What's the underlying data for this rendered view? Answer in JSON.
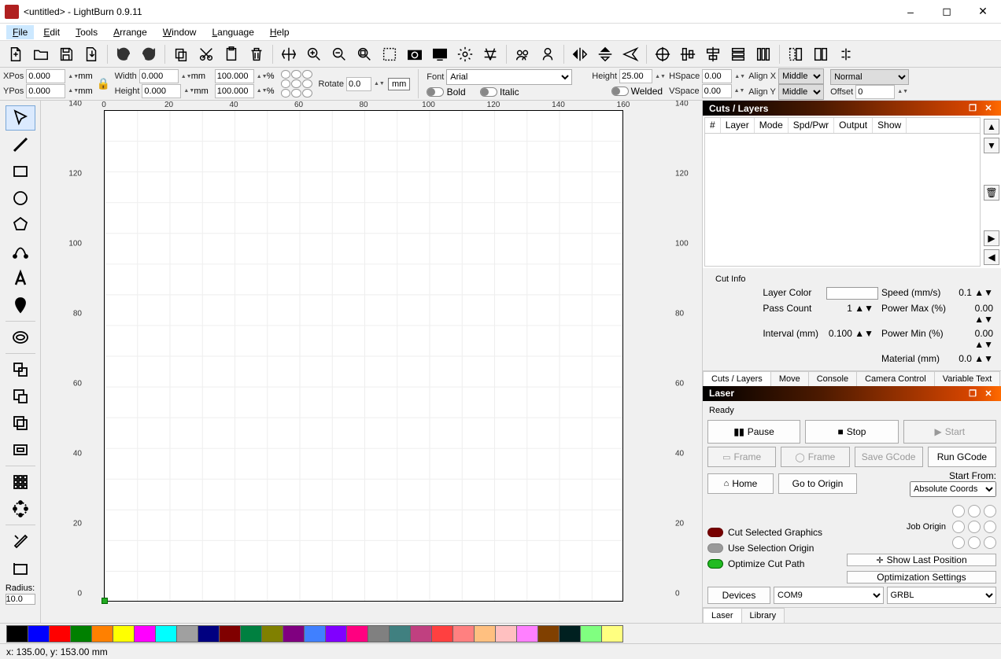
{
  "title": "<untitled> - LightBurn 0.9.11",
  "menu": [
    "File",
    "Edit",
    "Tools",
    "Arrange",
    "Window",
    "Language",
    "Help"
  ],
  "active_menu": 0,
  "props": {
    "xpos_label": "XPos",
    "xpos": "0.000",
    "xpos_unit": "mm",
    "ypos_label": "YPos",
    "ypos": "0.000",
    "ypos_unit": "mm",
    "width_label": "Width",
    "width": "0.000",
    "width_unit": "mm",
    "height_label": "Height",
    "height": "0.000",
    "height_unit": "mm",
    "scale_w": "100.000",
    "scale_h": "100.000",
    "scale_unit": "%",
    "rotate_label": "Rotate",
    "rotate": "0.0",
    "mm_btn": "mm",
    "font_label": "Font",
    "font": "Arial",
    "height_txt_label": "Height",
    "height_txt": "25.00",
    "hspace_label": "HSpace",
    "hspace": "0.00",
    "vspace_label": "VSpace",
    "vspace": "0.00",
    "alignx_label": "Align X",
    "alignx": "Middle",
    "aligny_label": "Align Y",
    "aligny": "Middle",
    "normal": "Normal",
    "offset_label": "Offset",
    "offset": "0",
    "bold": "Bold",
    "italic": "Italic",
    "welded": "Welded"
  },
  "radius_label": "Radius:",
  "radius_value": "10.0",
  "canvas_ticks": [
    "0",
    "20",
    "40",
    "60",
    "80",
    "100",
    "120",
    "140",
    "160"
  ],
  "canvas_ticks_v": [
    "0",
    "20",
    "40",
    "60",
    "80",
    "100",
    "120",
    "140"
  ],
  "panels": {
    "cuts_title": "Cuts / Layers",
    "cuts_headers": [
      "#",
      "Layer",
      "Mode",
      "Spd/Pwr",
      "Output",
      "Show"
    ],
    "cutinfo_title": "Cut Info",
    "cutinfo": {
      "layer_color": "Layer Color",
      "speed": "Speed (mm/s)",
      "speed_v": "0.1",
      "pass": "Pass Count",
      "pass_v": "1",
      "pmax": "Power Max (%)",
      "pmax_v": "0.00",
      "interval": "Interval (mm)",
      "interval_v": "0.100",
      "pmin": "Power Min (%)",
      "pmin_v": "0.00",
      "material": "Material (mm)",
      "material_v": "0.0"
    },
    "cuts_tabs": [
      "Cuts / Layers",
      "Move",
      "Console",
      "Camera Control",
      "Variable Text"
    ],
    "laser_title": "Laser",
    "ready": "Ready",
    "pause": "Pause",
    "stop": "Stop",
    "start": "Start",
    "frame": "Frame",
    "frame2": "Frame",
    "savegc": "Save GCode",
    "rungc": "Run GCode",
    "home": "Home",
    "goto": "Go to Origin",
    "startfrom": "Start From:",
    "startfrom_v": "Absolute Coords",
    "joborigin": "Job Origin",
    "cutsel": "Cut Selected Graphics",
    "usesel": "Use Selection Origin",
    "optcut": "Optimize Cut Path",
    "showlast": "Show Last Position",
    "optset": "Optimization Settings",
    "devices": "Devices",
    "port": "COM9",
    "ctrl": "GRBL",
    "laser_tabs": [
      "Laser",
      "Library"
    ]
  },
  "palette": [
    "#000000",
    "#0000ff",
    "#ff0000",
    "#008000",
    "#ff8000",
    "#ffff00",
    "#ff00ff",
    "#00ffff",
    "#a0a0a0",
    "#000080",
    "#800000",
    "#008040",
    "#808000",
    "#800080",
    "#4080ff",
    "#8000ff",
    "#ff0080",
    "#808080",
    "#408080",
    "#c04080",
    "#ff4040",
    "#ff8080",
    "#ffc080",
    "#ffc0c0",
    "#ff80ff",
    "#804000",
    "#002020",
    "#80ff80",
    "#ffff80"
  ],
  "status": "x: 135.00, y: 153.00 mm"
}
